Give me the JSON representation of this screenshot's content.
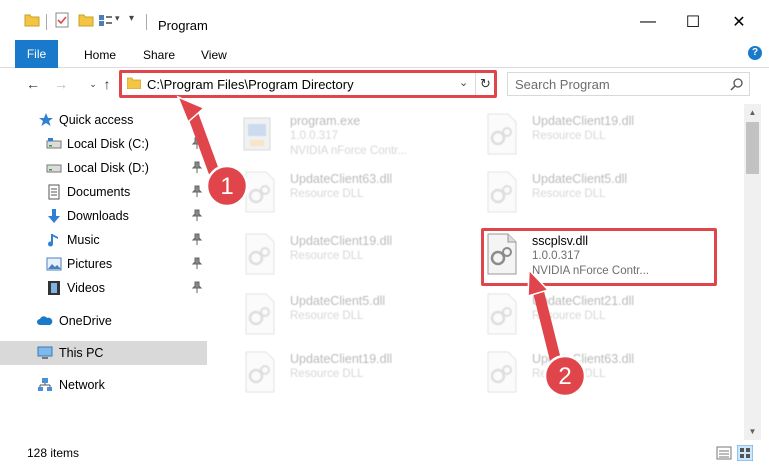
{
  "window": {
    "title": "Program",
    "minimize": "—",
    "maximize": "☐",
    "close": "✕"
  },
  "ribbon": {
    "tabs": [
      "File",
      "Home",
      "Share",
      "View"
    ],
    "help": "?"
  },
  "address": {
    "path": "C:\\Program Files\\Program Directory",
    "dropdown": "⌄",
    "refresh": "↻"
  },
  "search": {
    "placeholder": "Search Program"
  },
  "nav": {
    "back": "←",
    "forward": "→",
    "up": "↑",
    "recent": "⌄",
    "items": [
      {
        "label": "Quick access",
        "icon": "star-icon"
      },
      {
        "label": "Local Disk (C:)",
        "icon": "drive-icon"
      },
      {
        "label": "Local Disk (D:)",
        "icon": "drive-icon"
      },
      {
        "label": "Documents",
        "icon": "documents-icon"
      },
      {
        "label": "Downloads",
        "icon": "download-icon"
      },
      {
        "label": "Music",
        "icon": "music-icon"
      },
      {
        "label": "Pictures",
        "icon": "pictures-icon"
      },
      {
        "label": "Videos",
        "icon": "videos-icon"
      },
      {
        "label": "OneDrive",
        "icon": "cloud-icon"
      },
      {
        "label": "This PC",
        "icon": "computer-icon"
      },
      {
        "label": "Network",
        "icon": "network-icon"
      }
    ]
  },
  "files": [
    {
      "name": "program.exe",
      "line1": "1.0.0.317",
      "line2": "NVIDIA nForce Contr..."
    },
    {
      "name": "UpdateClient19.dll",
      "line1": "Resource DLL",
      "line2": ""
    },
    {
      "name": "UpdateClient63.dll",
      "line1": "Resource DLL",
      "line2": ""
    },
    {
      "name": "UpdateClient5.dll",
      "line1": "Resource DLL",
      "line2": ""
    },
    {
      "name": "UpdateClient19.dll",
      "line1": "Resource DLL",
      "line2": ""
    },
    {
      "name": "sscplsv.dll",
      "line1": "1.0.0.317",
      "line2": "NVIDIA nForce Contr..."
    },
    {
      "name": "UpdateClient5.dll",
      "line1": "Resource DLL",
      "line2": ""
    },
    {
      "name": "UpdateClient21.dll",
      "line1": "Resource DLL",
      "line2": ""
    },
    {
      "name": "UpdateClient19.dll",
      "line1": "Resource DLL",
      "line2": ""
    },
    {
      "name": "UpdateClient63.dll",
      "line1": "Resource DLL",
      "line2": ""
    }
  ],
  "status": {
    "count": "128 items"
  },
  "annotations": {
    "step1": "1",
    "step2": "2",
    "color": "#e0454b"
  }
}
